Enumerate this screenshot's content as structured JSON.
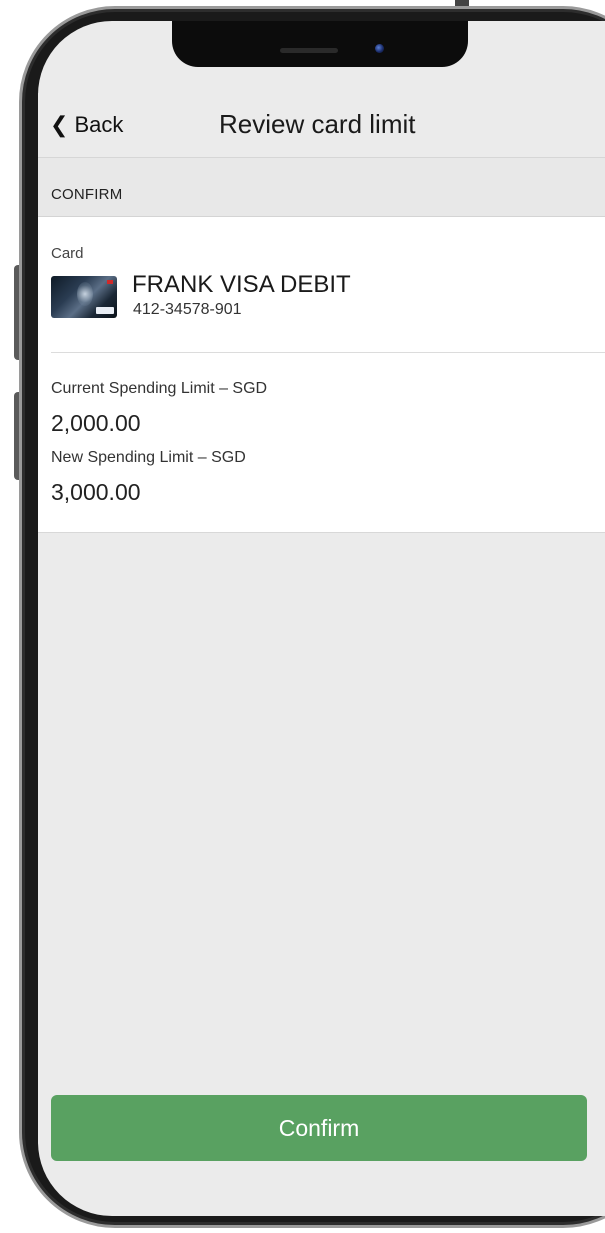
{
  "navbar": {
    "back_label": "Back",
    "title": "Review card limit"
  },
  "section": {
    "header": "CONFIRM"
  },
  "card": {
    "label": "Card",
    "name": "FRANK VISA DEBIT",
    "number": "412-34578-901"
  },
  "limits": {
    "current_label": "Current Spending Limit – SGD",
    "current_value": "2,000.00",
    "new_label": "New Spending Limit – SGD",
    "new_value": "3,000.00"
  },
  "actions": {
    "confirm_label": "Confirm"
  },
  "colors": {
    "confirm_button": "#59a161",
    "screen_background": "#ebebeb",
    "panel_background": "#ffffff"
  },
  "icons": {
    "back": "chevron-left-icon",
    "card_thumbnail": "card-image"
  }
}
